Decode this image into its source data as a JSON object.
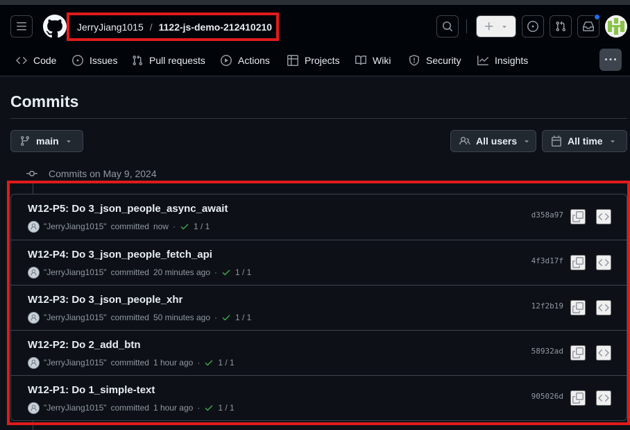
{
  "header": {
    "owner": "JerryJiang1015",
    "separator": "/",
    "repo": "1122-js-demo-212410210"
  },
  "nav": {
    "items": [
      {
        "label": "Code",
        "icon": "code-icon"
      },
      {
        "label": "Issues",
        "icon": "issue-opened-icon"
      },
      {
        "label": "Pull requests",
        "icon": "git-pull-request-icon"
      },
      {
        "label": "Actions",
        "icon": "play-icon"
      },
      {
        "label": "Projects",
        "icon": "table-icon"
      },
      {
        "label": "Wiki",
        "icon": "book-icon"
      },
      {
        "label": "Security",
        "icon": "shield-icon"
      },
      {
        "label": "Insights",
        "icon": "graph-icon"
      }
    ]
  },
  "page": {
    "title": "Commits",
    "branch": "main",
    "users_filter": "All users",
    "time_filter": "All time",
    "date_heading": "Commits on May 9, 2024"
  },
  "commits": [
    {
      "message": "W12-P5: Do 3_json_people_async_await",
      "author": "\"JerryJiang1015\"",
      "action": "committed",
      "time": "now",
      "checks": "1 / 1",
      "sha": "d358a97"
    },
    {
      "message": "W12-P4: Do 3_json_people_fetch_api",
      "author": "\"JerryJiang1015\"",
      "action": "committed",
      "time": "20 minutes ago",
      "checks": "1 / 1",
      "sha": "4f3d17f"
    },
    {
      "message": "W12-P3: Do 3_json_people_xhr",
      "author": "\"JerryJiang1015\"",
      "action": "committed",
      "time": "50 minutes ago",
      "checks": "1 / 1",
      "sha": "12f2b19"
    },
    {
      "message": "W12-P2: Do 2_add_btn",
      "author": "\"JerryJiang1015\"",
      "action": "committed",
      "time": "1 hour ago",
      "checks": "1 / 1",
      "sha": "58932ad"
    },
    {
      "message": "W12-P1: Do 1_simple-text",
      "author": "\"JerryJiang1015\"",
      "action": "committed",
      "time": "1 hour ago",
      "checks": "1 / 1",
      "sha": "905026d"
    }
  ],
  "colors": {
    "background": "#0d1117",
    "header_background": "#010409",
    "border": "#3d444d",
    "text": "#e6edf3",
    "muted": "#9198a1",
    "success": "#3fb950",
    "notification": "#1f6feb",
    "annotation_red": "#e11b1b"
  }
}
